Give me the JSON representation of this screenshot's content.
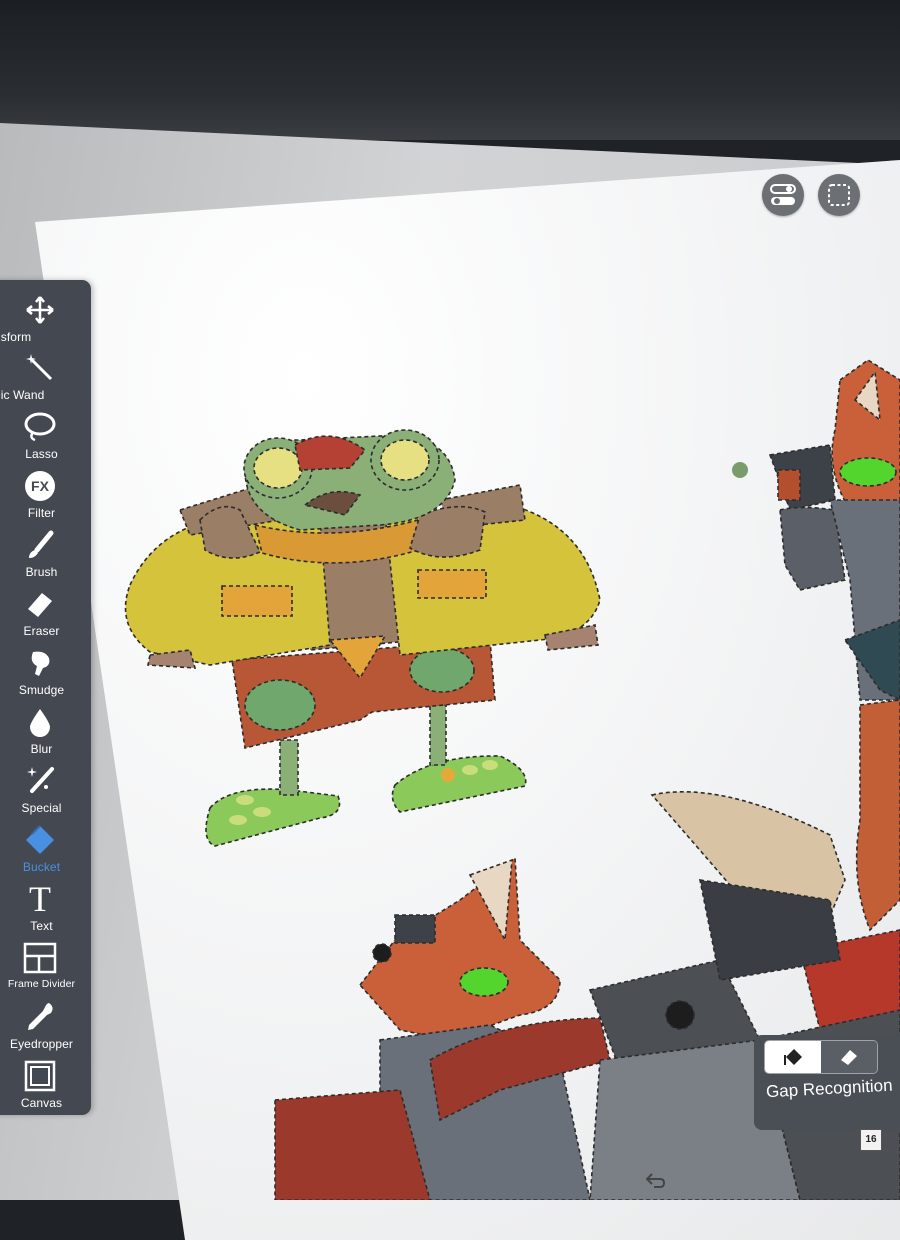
{
  "toolbar": {
    "tools": [
      {
        "label": "nsform",
        "icon": "move-arrows-icon"
      },
      {
        "label": "gic Wand",
        "icon": "magic-wand-icon"
      },
      {
        "label": "Lasso",
        "icon": "lasso-icon"
      },
      {
        "label": "Filter",
        "icon": "fx-filter-icon",
        "icon_text": "FX"
      },
      {
        "label": "Brush",
        "icon": "brush-icon"
      },
      {
        "label": "Eraser",
        "icon": "eraser-icon"
      },
      {
        "label": "Smudge",
        "icon": "smudge-finger-icon"
      },
      {
        "label": "Blur",
        "icon": "droplet-icon"
      },
      {
        "label": "Special",
        "icon": "sparkle-pen-icon"
      },
      {
        "label": "Bucket",
        "icon": "paint-bucket-icon",
        "active": true
      },
      {
        "label": "Text",
        "icon": "text-t-icon",
        "icon_text": "T"
      },
      {
        "label": "Frame Divider",
        "icon": "frame-divider-icon"
      },
      {
        "label": "Eyedropper",
        "icon": "eyedropper-icon"
      },
      {
        "label": "Canvas",
        "icon": "canvas-square-icon"
      }
    ],
    "active_color": "#4a90e2"
  },
  "top_controls": [
    {
      "name": "toggle-settings-icon"
    },
    {
      "name": "selection-frame-icon"
    }
  ],
  "gap_panel": {
    "label": "Gap Recognition",
    "selected": "fill"
  },
  "page_badge": "16"
}
